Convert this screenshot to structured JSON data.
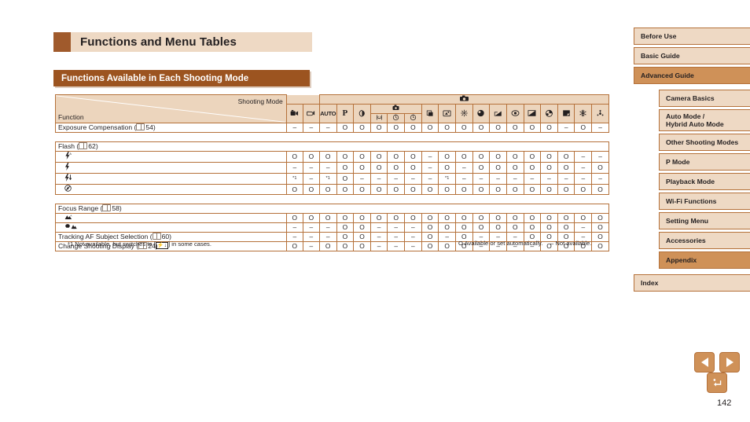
{
  "page": {
    "title": "Functions and Menu Tables",
    "section_heading": "Functions Available in Each Shooting Mode",
    "page_number": "142"
  },
  "table": {
    "corner": {
      "shooting_mode_label": "Shooting Mode",
      "function_label": "Function"
    },
    "mode_groups": [
      {
        "icon": "movie-digest-icon",
        "glyph": "ð"
      },
      {
        "icon": "hybrid-auto-icon",
        "glyph": "ñ"
      },
      {
        "icon": "camera-icon",
        "glyph": "■",
        "label": "camera"
      }
    ],
    "mode_columns": [
      {
        "icon": "movie-mode-icon",
        "glyph": "🎥"
      },
      {
        "icon": "hybrid-auto-mode-icon",
        "glyph": "📹"
      },
      {
        "icon": "auto-mode-icon",
        "glyph": "AUTO"
      },
      {
        "icon": "program-mode-icon",
        "glyph": "P"
      },
      {
        "icon": "portrait-mode-icon",
        "glyph": "◕"
      },
      {
        "icon": "smile-mode-icon",
        "glyph": "☻"
      },
      {
        "icon": "wink-selftimer-icon",
        "glyph": "☺"
      },
      {
        "icon": "face-selftimer-icon",
        "glyph": "☺"
      },
      {
        "icon": "handheld-nightscene-icon",
        "glyph": "❐"
      },
      {
        "icon": "low-light-icon",
        "glyph": "▣"
      },
      {
        "icon": "fireworks-icon",
        "glyph": "✹"
      },
      {
        "icon": "fish-eye-icon",
        "glyph": "◔"
      },
      {
        "icon": "miniature-icon",
        "glyph": "◢"
      },
      {
        "icon": "toy-camera-icon",
        "glyph": "◎"
      },
      {
        "icon": "monochrome-icon",
        "glyph": "◨"
      },
      {
        "icon": "super-vivid-icon",
        "glyph": "◖"
      },
      {
        "icon": "poster-effect-icon",
        "glyph": "▮"
      },
      {
        "icon": "snow-icon",
        "glyph": "❄"
      },
      {
        "icon": "long-shutter-icon",
        "glyph": "⁂"
      }
    ],
    "subgroup": {
      "icon": "portrait-group-icon",
      "glyph": "◕",
      "span_start": 5,
      "span_count": 3
    },
    "rows": [
      {
        "type": "data",
        "label": "Exposure Compensation (",
        "ref": "54",
        "indent": false,
        "values": [
          "–",
          "–",
          "–",
          "O",
          "O",
          "O",
          "O",
          "O",
          "O",
          "O",
          "O",
          "O",
          "O",
          "O",
          "O",
          "O",
          "–",
          "O",
          "–"
        ]
      },
      {
        "type": "group",
        "label": "Flash (",
        "ref": "62"
      },
      {
        "type": "data",
        "glyph": "flash-auto-icon",
        "glyph_text": "⚡A",
        "indent": true,
        "values": [
          "O",
          "O",
          "O",
          "O",
          "O",
          "O",
          "O",
          "O",
          "–",
          "O",
          "O",
          "O",
          "O",
          "O",
          "O",
          "O",
          "O",
          "–",
          "–"
        ]
      },
      {
        "type": "data",
        "glyph": "flash-on-icon",
        "glyph_text": "⚡",
        "indent": true,
        "values": [
          "–",
          "–",
          "–",
          "O",
          "O",
          "O",
          "O",
          "O",
          "–",
          "O",
          "–",
          "O",
          "O",
          "O",
          "O",
          "O",
          "O",
          "–",
          "O"
        ]
      },
      {
        "type": "data",
        "glyph": "slow-synchro-icon",
        "glyph_text": "⚡↓",
        "indent": true,
        "values": [
          "*1",
          "–",
          "*1",
          "O",
          "–",
          "–",
          "–",
          "–",
          "–",
          "*1",
          "–",
          "–",
          "–",
          "–",
          "–",
          "–",
          "–",
          "–",
          "–"
        ]
      },
      {
        "type": "data",
        "glyph": "flash-off-icon",
        "glyph_text": "ⓢ",
        "indent": true,
        "values": [
          "O",
          "O",
          "O",
          "O",
          "O",
          "O",
          "O",
          "O",
          "O",
          "O",
          "O",
          "O",
          "O",
          "O",
          "O",
          "O",
          "O",
          "O",
          "O"
        ]
      },
      {
        "type": "group",
        "label": "Focus Range (",
        "ref": "58"
      },
      {
        "type": "data",
        "glyph": "normal-focus-icon",
        "glyph_text": "▲A",
        "indent": true,
        "values": [
          "O",
          "O",
          "O",
          "O",
          "O",
          "O",
          "O",
          "O",
          "O",
          "O",
          "O",
          "O",
          "O",
          "O",
          "O",
          "O",
          "O",
          "O",
          "O"
        ]
      },
      {
        "type": "data",
        "glyph": "macro-infinity-icon",
        "glyph_text": "❀ ▲",
        "indent": true,
        "values": [
          "–",
          "–",
          "–",
          "O",
          "O",
          "–",
          "–",
          "–",
          "O",
          "O",
          "O",
          "O",
          "O",
          "O",
          "O",
          "O",
          "O",
          "–",
          "O"
        ]
      },
      {
        "type": "data",
        "label": "Tracking AF Subject Selection (",
        "ref": "60",
        "indent": false,
        "values": [
          "–",
          "–",
          "–",
          "O",
          "O",
          "–",
          "–",
          "–",
          "O",
          "–",
          "O",
          "–",
          "–",
          "–",
          "O",
          "O",
          "O",
          "–",
          "O"
        ]
      },
      {
        "type": "data",
        "label": "Change Shooting Display (",
        "ref": "24",
        "indent": false,
        "values": [
          "O",
          "–",
          "O",
          "O",
          "O",
          "–",
          "–",
          "–",
          "O",
          "O",
          "O",
          "–",
          "–",
          "–",
          "–",
          "O",
          "O",
          "O",
          "O"
        ]
      }
    ],
    "footnote_left_pre": "*1 Not available, but switches to [",
    "footnote_left_glyph": "⚡↓",
    "footnote_left_post": "] in some cases.",
    "footnote_right": "O Available or set automatically.  – Not available."
  },
  "sidebar": {
    "items": [
      {
        "label": "Before Use",
        "level": 1,
        "active": false
      },
      {
        "label": "Basic Guide",
        "level": 1,
        "active": false
      },
      {
        "label": "Advanced Guide",
        "level": 1,
        "active": true
      },
      {
        "label": "Camera Basics",
        "level": 2,
        "active": false
      },
      {
        "label": "Auto Mode /",
        "label2": "Hybrid Auto Mode",
        "level": 2,
        "active": false,
        "tall": true
      },
      {
        "label": "Other Shooting Modes",
        "level": 2,
        "active": false
      },
      {
        "label": "P Mode",
        "level": 2,
        "active": false
      },
      {
        "label": "Playback Mode",
        "level": 2,
        "active": false
      },
      {
        "label": "Wi-Fi Functions",
        "level": 2,
        "active": false
      },
      {
        "label": "Setting Menu",
        "level": 2,
        "active": false
      },
      {
        "label": "Accessories",
        "level": 2,
        "active": false
      },
      {
        "label": "Appendix",
        "level": 2,
        "active": true
      },
      {
        "label": "Index",
        "level": 1,
        "active": false
      }
    ]
  },
  "nav": {
    "prev_label": "previous-page",
    "next_label": "next-page",
    "back_label": "↩"
  },
  "colors": {
    "accent_dark": "#9c5420",
    "accent_mid": "#cf9158",
    "accent_light": "#eed9c4",
    "table_border": "#b5713a",
    "header_band": "#ecd5bd"
  }
}
